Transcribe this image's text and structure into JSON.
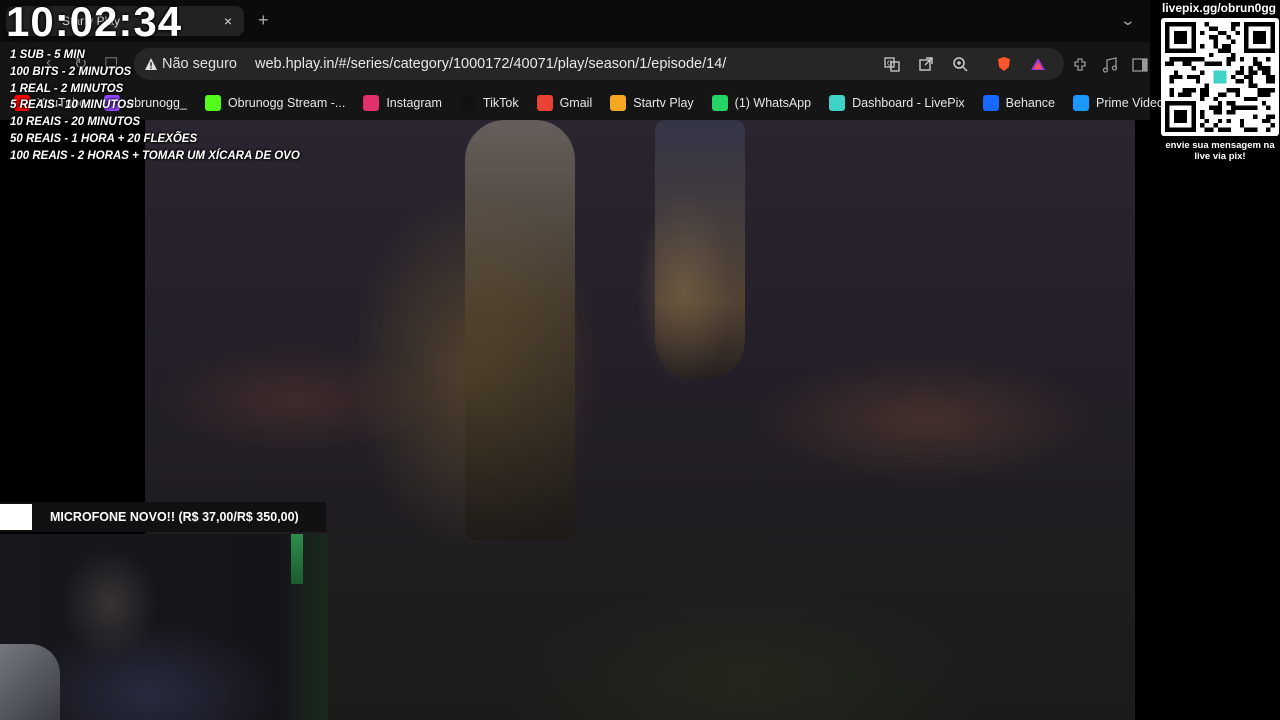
{
  "overlay": {
    "clock": "10:02:34",
    "rules": [
      "1 SUB - 5 MIN",
      "100 BITS - 2 MINUTOS",
      "1 REAL - 2 MINUTOS",
      "5 REAIS - 10 MINUTOS",
      "10 REAIS - 20 MINUTOS",
      "50 REAIS - 1 HORA + 20 FLEXÕES",
      "100 REAIS - 2 HORAS + TOMAR UM XÍCARA DE OVO"
    ],
    "goal_label": "MICROFONE NOVO!! (R$ 37,00/R$ 350,00)",
    "goal_progress": 0.106,
    "pix_url": "livepix.gg/obrun0gg",
    "pix_note": "envie sua mensagem na live via pix!"
  },
  "browser": {
    "tab_label": "Startv Play",
    "tab_close": "×",
    "new_tab": "+",
    "security_label": "Não seguro",
    "url": "web.hplay.in/#/series/category/1000172/40071/play/season/1/episode/14/",
    "bookmarks": [
      {
        "label": "YouTube",
        "icon": "youtube-icon",
        "color": "#ff0000"
      },
      {
        "label": "obrunogg_",
        "icon": "twitch-icon",
        "color": "#9146ff"
      },
      {
        "label": "Obrunogg Stream -...",
        "icon": "kick-icon",
        "color": "#53fc18"
      },
      {
        "label": "Instagram",
        "icon": "instagram-icon",
        "color": "#e1306c"
      },
      {
        "label": "TikTok",
        "icon": "tiktok-icon",
        "color": "#111111"
      },
      {
        "label": "Gmail",
        "icon": "gmail-icon",
        "color": "#ea4335"
      },
      {
        "label": "Startv Play",
        "icon": "startv-icon",
        "color": "#f5a623"
      },
      {
        "label": "(1) WhatsApp",
        "icon": "whatsapp-icon",
        "color": "#25d366"
      },
      {
        "label": "Dashboard - LivePix",
        "icon": "livepix-icon",
        "color": "#3fd2c7"
      },
      {
        "label": "Behance",
        "icon": "behance-icon",
        "color": "#1769ff"
      },
      {
        "label": "Prime Video: assista...",
        "icon": "prime-video-icon",
        "color": "#1a98ff"
      }
    ]
  }
}
